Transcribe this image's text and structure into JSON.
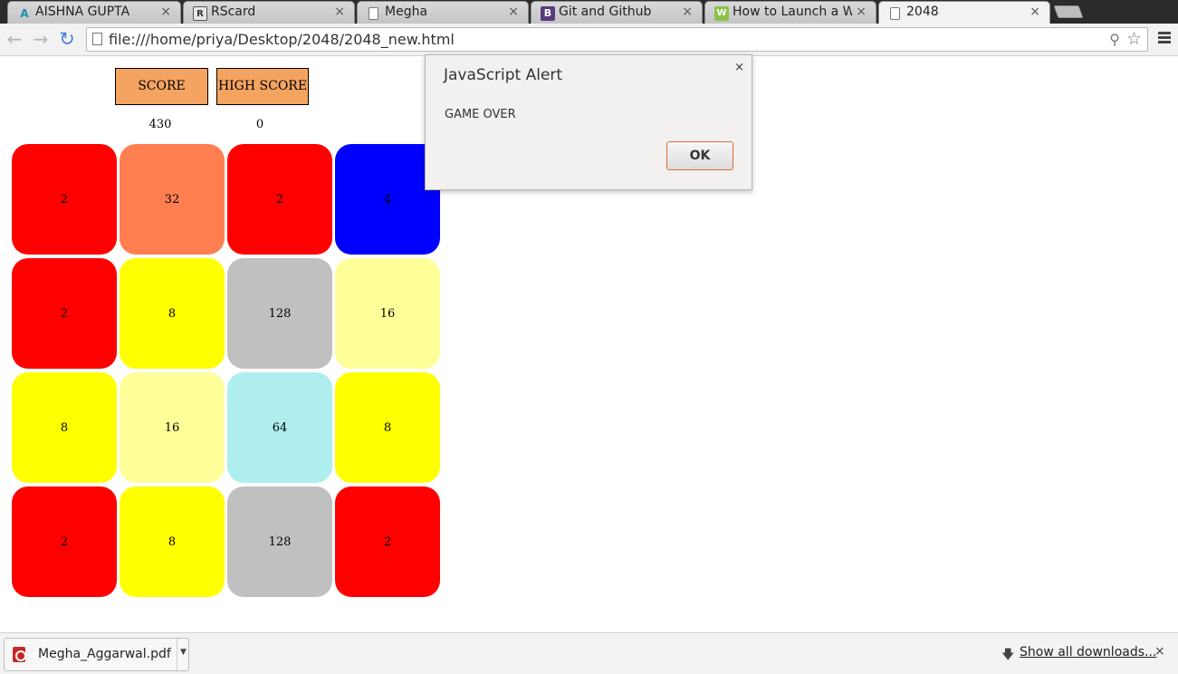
{
  "browser": {
    "tabs": [
      {
        "title": "AISHNA GUPTA",
        "icon": "aishna-favicon",
        "active": false
      },
      {
        "title": "RScard",
        "icon": "rscard-favicon",
        "active": false
      },
      {
        "title": "Megha",
        "icon": "page-icon",
        "active": false
      },
      {
        "title": "Git and Github",
        "icon": "bootstrap-favicon",
        "active": false
      },
      {
        "title": "How to Launch a Web",
        "icon": "wiki-favicon",
        "active": false
      },
      {
        "title": "2048",
        "icon": "page-icon",
        "active": true
      }
    ],
    "tab_close_glyph": "×",
    "url": "file:///home/priya/Desktop/2048/2048_new.html"
  },
  "game": {
    "score_label": "SCORE",
    "high_score_label": "HIGH SCORE",
    "score_value": "430",
    "high_score_value": "0",
    "board": [
      [
        "2",
        "32",
        "2",
        "4"
      ],
      [
        "2",
        "8",
        "128",
        "16"
      ],
      [
        "8",
        "16",
        "64",
        "8"
      ],
      [
        "2",
        "8",
        "128",
        "2"
      ]
    ],
    "colors": {
      "2": "#ff0000",
      "4": "#0000ff",
      "8": "#ffff00",
      "16": "#ffff99",
      "32": "#ff7f50",
      "64": "#afeeee",
      "128": "#c0c0c0",
      "score_button": "#f4a460"
    }
  },
  "alert": {
    "title": "JavaScript Alert",
    "close_glyph": "×",
    "message": "GAME OVER",
    "ok_label": "OK"
  },
  "downloads": {
    "file_name": "Megha_Aggarwal.pdf",
    "show_all_label": "Show all downloads...",
    "close_glyph": "×"
  }
}
